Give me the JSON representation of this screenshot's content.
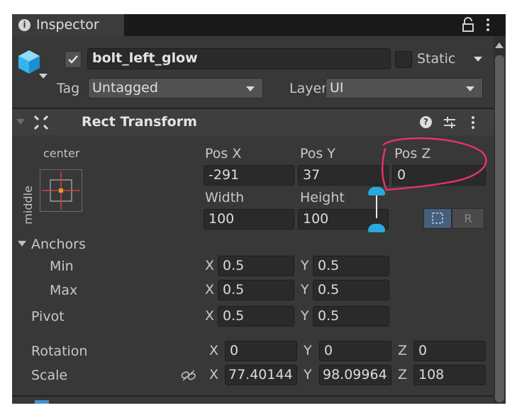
{
  "tab": {
    "title": "Inspector"
  },
  "object": {
    "name": "bolt_left_glow",
    "static_label": "Static",
    "tag_label": "Tag",
    "tag_value": "Untagged",
    "layer_label": "Layer",
    "layer_value": "UI"
  },
  "component": {
    "title": "Rect Transform"
  },
  "anchor_preset": {
    "horizontal": "center",
    "vertical": "middle"
  },
  "pos": {
    "x_label": "Pos X",
    "y_label": "Pos Y",
    "z_label": "Pos Z",
    "x": "-291",
    "y": "37",
    "z": "0"
  },
  "size": {
    "width_label": "Width",
    "height_label": "Height",
    "width": "100",
    "height": "100",
    "raw_button": "R"
  },
  "anchors": {
    "label": "Anchors",
    "min_label": "Min",
    "max_label": "Max",
    "min_x": "0.5",
    "min_y": "0.5",
    "max_x": "0.5",
    "max_y": "0.5"
  },
  "pivot": {
    "label": "Pivot",
    "x": "0.5",
    "y": "0.5"
  },
  "rotation": {
    "label": "Rotation",
    "x": "0",
    "y": "0",
    "z": "0"
  },
  "scale": {
    "label": "Scale",
    "x": "77.40144",
    "y": "98.09964",
    "z": "108"
  },
  "axes": {
    "x": "X",
    "y": "Y",
    "z": "Z"
  },
  "colors": {
    "panel": "#383838",
    "header": "#3e3e3e",
    "field": "#2a2a2a",
    "annotation": "#e8336a",
    "accent": "#2aa9e0"
  }
}
